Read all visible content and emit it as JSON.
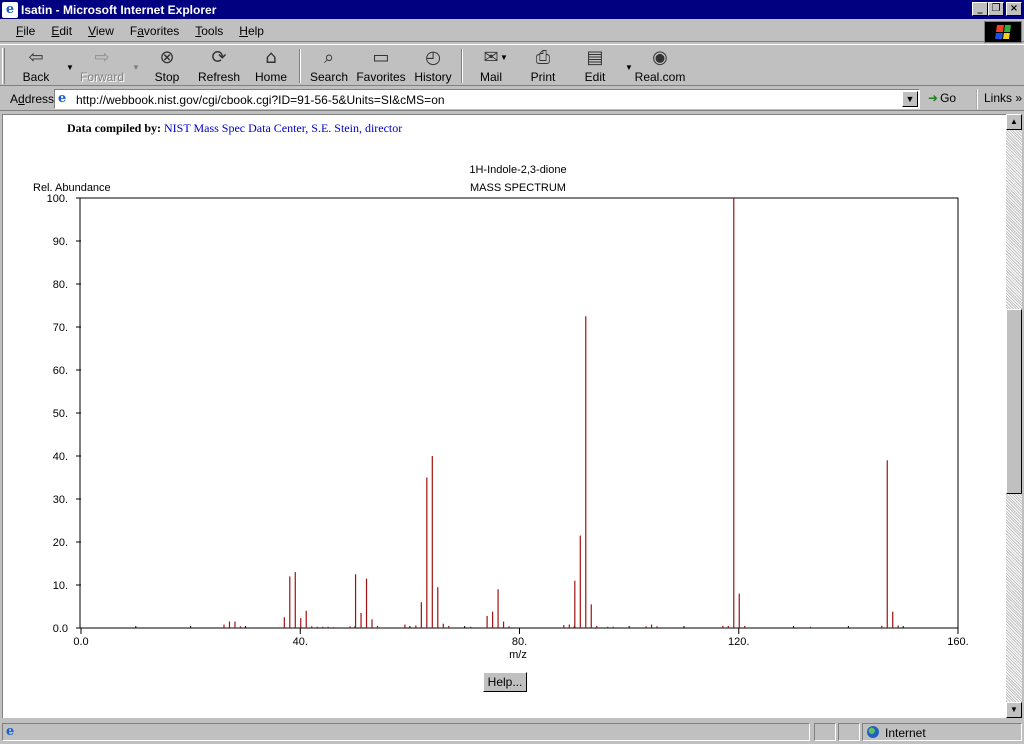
{
  "window": {
    "title": "Isatin - Microsoft Internet Explorer",
    "icon": "ie-icon",
    "controls": {
      "minimize": "_",
      "maximize": "❐",
      "close": "×"
    }
  },
  "menu": {
    "items": [
      {
        "pre": "",
        "key": "F",
        "post": "ile"
      },
      {
        "pre": "",
        "key": "E",
        "post": "dit"
      },
      {
        "pre": "",
        "key": "V",
        "post": "iew"
      },
      {
        "pre": "F",
        "key": "a",
        "post": "vorites"
      },
      {
        "pre": "",
        "key": "T",
        "post": "ools"
      },
      {
        "pre": "",
        "key": "H",
        "post": "elp"
      }
    ]
  },
  "toolbar": {
    "back": "Back",
    "forward": "Forward",
    "stop": "Stop",
    "refresh": "Refresh",
    "home": "Home",
    "search": "Search",
    "favorites": "Favorites",
    "history": "History",
    "mail": "Mail",
    "print": "Print",
    "edit": "Edit",
    "realcom": "Real.com"
  },
  "address": {
    "label_pre": "A",
    "label_key": "d",
    "label_post": "dress",
    "url": "http://webbook.nist.gov/cgi/cbook.cgi?ID=91-56-5&Units=SI&cMS=on",
    "go": "Go",
    "links": "Links"
  },
  "page": {
    "compiled_label": "Data compiled by:",
    "compiled_by": "NIST Mass Spec Data Center, S.E. Stein, director",
    "help_button": "Help..."
  },
  "chart_data": {
    "type": "bar",
    "title": "1H-Indole-2,3-dione",
    "subtitle": "MASS SPECTRUM",
    "xlabel": "m/z",
    "ylabel": "Rel. Abundance",
    "xlim": [
      0,
      160
    ],
    "ylim": [
      0,
      100
    ],
    "x_ticks": [
      "0.0",
      "40.",
      "80.",
      "120.",
      "160."
    ],
    "x_tick_values": [
      0,
      40,
      80,
      120,
      160
    ],
    "y_ticks": [
      "0.0",
      "10.",
      "20.",
      "30.",
      "40.",
      "50.",
      "60.",
      "70.",
      "80.",
      "90.",
      "100."
    ],
    "y_tick_values": [
      0,
      10,
      20,
      30,
      40,
      50,
      60,
      70,
      80,
      90,
      100
    ],
    "grid": false,
    "bar_color": "#a01010",
    "peaks": [
      {
        "x": 26,
        "y": 0.8
      },
      {
        "x": 27,
        "y": 1.5
      },
      {
        "x": 28,
        "y": 1.5
      },
      {
        "x": 29,
        "y": 0.4
      },
      {
        "x": 37,
        "y": 2.5
      },
      {
        "x": 38,
        "y": 12.0
      },
      {
        "x": 39,
        "y": 13.0
      },
      {
        "x": 40,
        "y": 2.3
      },
      {
        "x": 41,
        "y": 4.0
      },
      {
        "x": 42,
        "y": 0.4
      },
      {
        "x": 43,
        "y": 0.3
      },
      {
        "x": 44,
        "y": 0.3
      },
      {
        "x": 45,
        "y": 0.3
      },
      {
        "x": 46,
        "y": 0.2
      },
      {
        "x": 49,
        "y": 0.4
      },
      {
        "x": 50,
        "y": 12.5
      },
      {
        "x": 51,
        "y": 3.5
      },
      {
        "x": 52,
        "y": 11.5
      },
      {
        "x": 53,
        "y": 2.0
      },
      {
        "x": 54,
        "y": 0.5
      },
      {
        "x": 59,
        "y": 0.8
      },
      {
        "x": 61,
        "y": 0.6
      },
      {
        "x": 62,
        "y": 6.0
      },
      {
        "x": 63,
        "y": 35.0
      },
      {
        "x": 64,
        "y": 40.0
      },
      {
        "x": 65,
        "y": 9.5
      },
      {
        "x": 66,
        "y": 1.0
      },
      {
        "x": 67,
        "y": 0.5
      },
      {
        "x": 71,
        "y": 0.3
      },
      {
        "x": 74,
        "y": 2.8
      },
      {
        "x": 75,
        "y": 3.8
      },
      {
        "x": 76,
        "y": 9.0
      },
      {
        "x": 77,
        "y": 1.5
      },
      {
        "x": 78,
        "y": 0.4
      },
      {
        "x": 88,
        "y": 0.7
      },
      {
        "x": 89,
        "y": 0.8
      },
      {
        "x": 90,
        "y": 11.0
      },
      {
        "x": 91,
        "y": 21.5
      },
      {
        "x": 92,
        "y": 72.5
      },
      {
        "x": 93,
        "y": 5.5
      },
      {
        "x": 94,
        "y": 0.5
      },
      {
        "x": 96,
        "y": 0.3
      },
      {
        "x": 97,
        "y": 0.3
      },
      {
        "x": 103,
        "y": 0.4
      },
      {
        "x": 104,
        "y": 0.8
      },
      {
        "x": 105,
        "y": 0.4
      },
      {
        "x": 117,
        "y": 0.5
      },
      {
        "x": 118,
        "y": 0.5
      },
      {
        "x": 119,
        "y": 100.0
      },
      {
        "x": 120,
        "y": 8.0
      },
      {
        "x": 121,
        "y": 0.5
      },
      {
        "x": 133,
        "y": 0.3
      },
      {
        "x": 146,
        "y": 0.5
      },
      {
        "x": 147,
        "y": 39.0
      },
      {
        "x": 148,
        "y": 3.8
      },
      {
        "x": 149,
        "y": 0.6
      }
    ]
  },
  "status": {
    "zone": "Internet"
  }
}
